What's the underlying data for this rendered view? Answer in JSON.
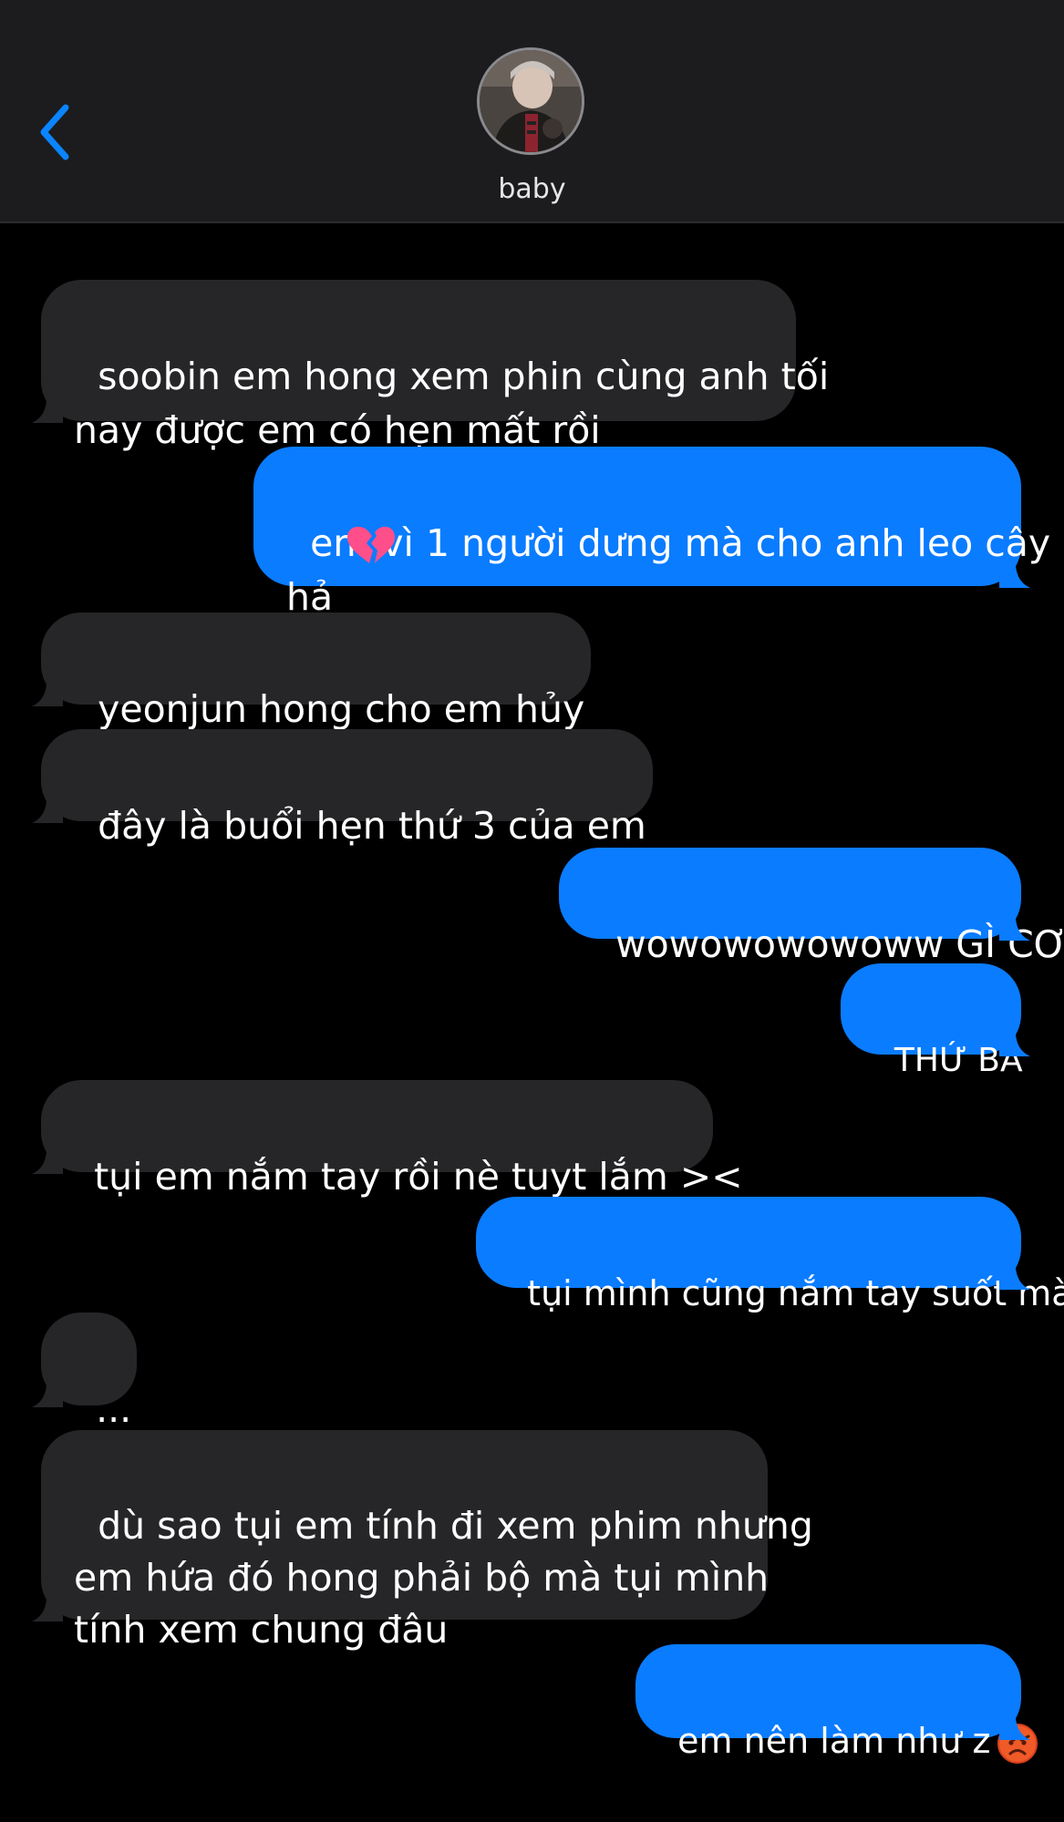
{
  "contact": {
    "name": "baby"
  },
  "messages": [
    {
      "id": "m1",
      "side": "in",
      "text": "soobin em hong xem phin cùng anh tối\nnay được em có hẹn mất rồi"
    },
    {
      "id": "m2",
      "side": "out",
      "text": "em vì 1 người dưng mà cho anh leo cây\nhả",
      "emoji": "broken-heart"
    },
    {
      "id": "m3",
      "side": "in",
      "text": "yeonjun hong cho em hủy"
    },
    {
      "id": "m4",
      "side": "in",
      "text": "đây là buổi hẹn thứ 3 của em"
    },
    {
      "id": "m5",
      "side": "out",
      "text": "wowowowowoww GÌ CƠ"
    },
    {
      "id": "m6",
      "side": "out",
      "text": "THỨ BA"
    },
    {
      "id": "m7",
      "side": "in",
      "text": "tụi em nắm tay rồi nè tuyt lắm ><"
    },
    {
      "id": "m8",
      "side": "out",
      "text": "tụi mình cũng nắm tay suốt mà"
    },
    {
      "id": "m9",
      "side": "in",
      "text": "..."
    },
    {
      "id": "m10",
      "side": "in",
      "text": "dù sao tụi em tính đi xem phim nhưng\nem hứa đó hong phải bộ mà tụi mình\ntính xem chung đâu"
    },
    {
      "id": "m11",
      "side": "out",
      "text": "em nên làm như z",
      "emoji": "angry-face"
    }
  ],
  "colors": {
    "incoming": "#262628",
    "outgoing": "#0a7cff",
    "header": "#1c1c1e",
    "back": "#0a84ff"
  }
}
